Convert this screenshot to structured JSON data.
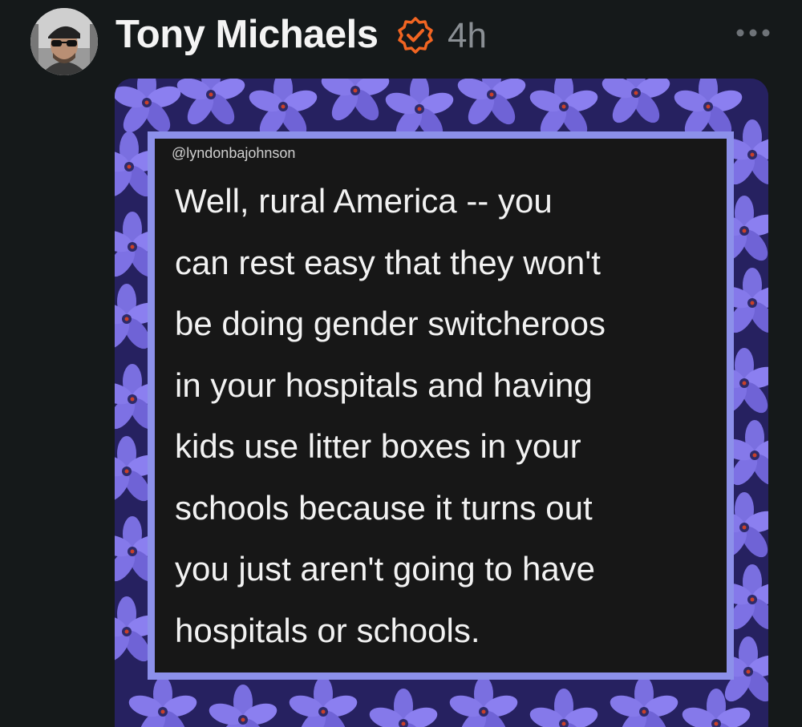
{
  "author": {
    "name": "Tony Michaels",
    "timestamp": "4h",
    "verified": true
  },
  "icons": {
    "avatar": "avatar-photo",
    "verified": "verified-badge-icon",
    "more": "more-options-icon"
  },
  "colors": {
    "background": "#15191a",
    "verified_badge": "#f26522",
    "card_border": "#8c90ea",
    "card_background": "#171717"
  },
  "media": {
    "handle": "@lyndonbajohnson",
    "quote_lines": [
      "Well, rural America -- you",
      "can rest easy that they won't",
      "be doing gender switcheroos",
      "in your hospitals and having",
      "kids use litter boxes in your",
      "schools because it turns out",
      "you just aren't going to have",
      "hospitals or schools."
    ]
  }
}
